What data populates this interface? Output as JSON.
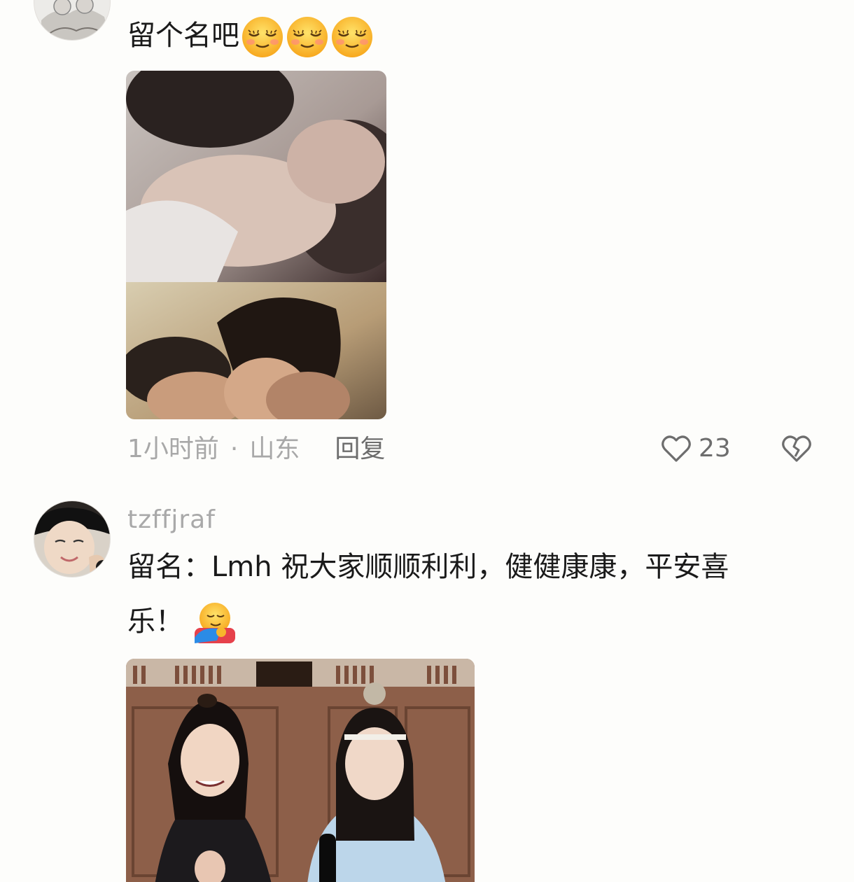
{
  "comments": [
    {
      "text": "留个名吧",
      "emojis": [
        "smiling-face-icon",
        "smiling-face-icon",
        "smiling-face-icon"
      ],
      "time": "1小时前",
      "separator": "·",
      "location": "山东",
      "reply_label": "回复",
      "like_count": "23"
    },
    {
      "username": "tzffjraf",
      "text_line1": "留名：Lmh  祝大家顺顺利利，健健康康，平安喜",
      "text_line2": "乐！",
      "emojis": [
        "hugging-face-icon"
      ]
    }
  ],
  "colors": {
    "background": "#fdfdfb",
    "text": "#1a1a1a",
    "meta": "#a8a8a8",
    "action": "#6d6d6d"
  }
}
